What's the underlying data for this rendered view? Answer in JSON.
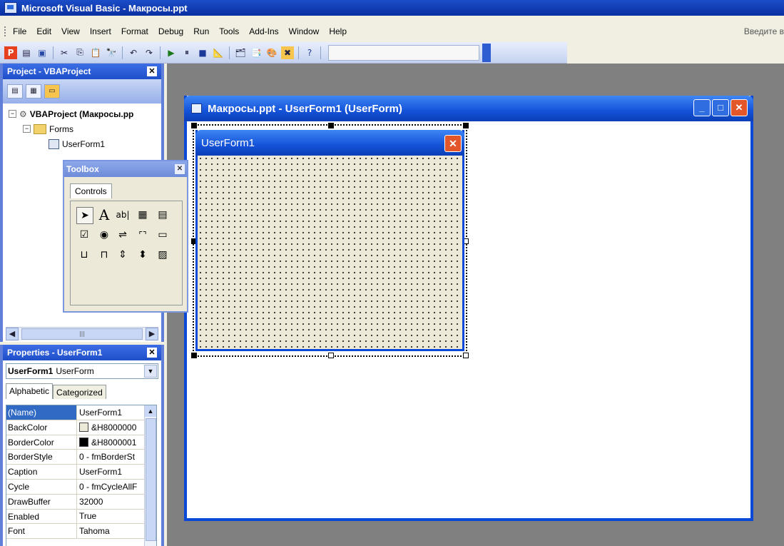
{
  "app": {
    "title": "Microsoft Visual Basic - Макросы.ppt"
  },
  "menu": {
    "items": [
      "File",
      "Edit",
      "View",
      "Insert",
      "Format",
      "Debug",
      "Run",
      "Tools",
      "Add-Ins",
      "Window",
      "Help"
    ],
    "ask_prompt": "Введите в"
  },
  "toolbar": {
    "icons": [
      "powerpoint-icon",
      "insert-userform-icon",
      "save-icon",
      "cut-icon",
      "copy-icon",
      "paste-icon",
      "find-icon",
      "undo-icon",
      "redo-icon",
      "run-icon",
      "break-icon",
      "reset-icon",
      "design-mode-icon",
      "project-explorer-icon",
      "properties-icon",
      "object-browser-icon",
      "toolbox-icon",
      "help-icon"
    ]
  },
  "project": {
    "title": "Project - VBAProject",
    "root": "VBAProject (Макросы.pp",
    "folder": "Forms",
    "item": "UserForm1"
  },
  "toolbox": {
    "title": "Toolbox",
    "tab": "Controls"
  },
  "properties": {
    "title": "Properties - UserForm1",
    "object_name": "UserForm1",
    "object_type": "UserForm",
    "tabs": [
      "Alphabetic",
      "Categorized"
    ],
    "rows": [
      {
        "name": "(Name)",
        "value": "UserForm1",
        "swatch": ""
      },
      {
        "name": "BackColor",
        "value": "&H8000000",
        "swatch": "#ece9d8"
      },
      {
        "name": "BorderColor",
        "value": "&H8000001",
        "swatch": "#000000"
      },
      {
        "name": "BorderStyle",
        "value": "0 - fmBorderSt",
        "swatch": ""
      },
      {
        "name": "Caption",
        "value": "UserForm1",
        "swatch": ""
      },
      {
        "name": "Cycle",
        "value": "0 - fmCycleAllF",
        "swatch": ""
      },
      {
        "name": "DrawBuffer",
        "value": "32000",
        "swatch": ""
      },
      {
        "name": "Enabled",
        "value": "True",
        "swatch": ""
      },
      {
        "name": "Font",
        "value": "Tahoma",
        "swatch": ""
      }
    ]
  },
  "designer": {
    "window_title": "Макросы.ppt - UserForm1 (UserForm)",
    "form_caption": "UserForm1"
  }
}
